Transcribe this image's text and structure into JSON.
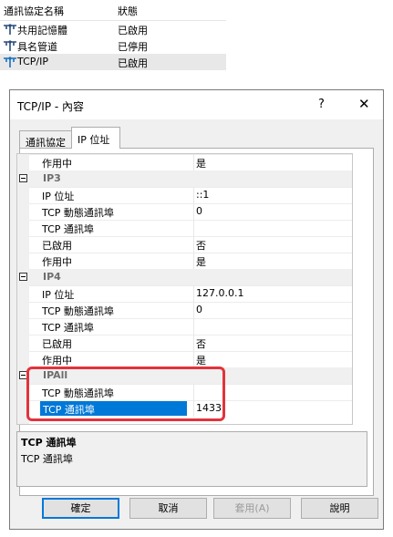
{
  "protocols": {
    "col_name": "通訊協定名稱",
    "col_status": "狀態",
    "rows": [
      {
        "name": "共用記憶體",
        "status": "已啟用",
        "icon": "protocol-icon"
      },
      {
        "name": "具名管道",
        "status": "已停用",
        "icon": "protocol-icon"
      },
      {
        "name": "TCP/IP",
        "status": "已啟用",
        "icon": "protocol-icon",
        "selected": true
      }
    ]
  },
  "dialog": {
    "title": "TCP/IP - 內容",
    "help_label": "?",
    "close_label": "✕",
    "tabs": [
      {
        "label": "通訊協定",
        "active": false
      },
      {
        "label": "IP 位址",
        "active": true
      }
    ],
    "grid": [
      {
        "type": "prop",
        "key": "作用中",
        "value": "是"
      },
      {
        "type": "cat",
        "key": "IP3"
      },
      {
        "type": "prop",
        "key": "IP 位址",
        "value": "::1"
      },
      {
        "type": "prop",
        "key": "TCP 動態通訊埠",
        "value": "0"
      },
      {
        "type": "prop",
        "key": "TCP 通訊埠",
        "value": ""
      },
      {
        "type": "prop",
        "key": "已啟用",
        "value": "否"
      },
      {
        "type": "prop",
        "key": "作用中",
        "value": "是"
      },
      {
        "type": "cat",
        "key": "IP4"
      },
      {
        "type": "prop",
        "key": "IP 位址",
        "value": "127.0.0.1"
      },
      {
        "type": "prop",
        "key": "TCP 動態通訊埠",
        "value": "0"
      },
      {
        "type": "prop",
        "key": "TCP 通訊埠",
        "value": ""
      },
      {
        "type": "prop",
        "key": "已啟用",
        "value": "否"
      },
      {
        "type": "prop",
        "key": "作用中",
        "value": "是"
      },
      {
        "type": "cat",
        "key": "IPAll"
      },
      {
        "type": "prop",
        "key": "TCP 動態通訊埠",
        "value": ""
      },
      {
        "type": "prop",
        "key": "TCP 通訊埠",
        "value": "1433",
        "selected": true
      }
    ],
    "description": {
      "title": "TCP 通訊埠",
      "text": "TCP 通訊埠"
    },
    "buttons": {
      "ok": "確定",
      "cancel": "取消",
      "apply": "套用(A)",
      "help": "說明"
    },
    "colors": {
      "selection": "#0078d7",
      "highlight_box": "#e2333b"
    }
  }
}
